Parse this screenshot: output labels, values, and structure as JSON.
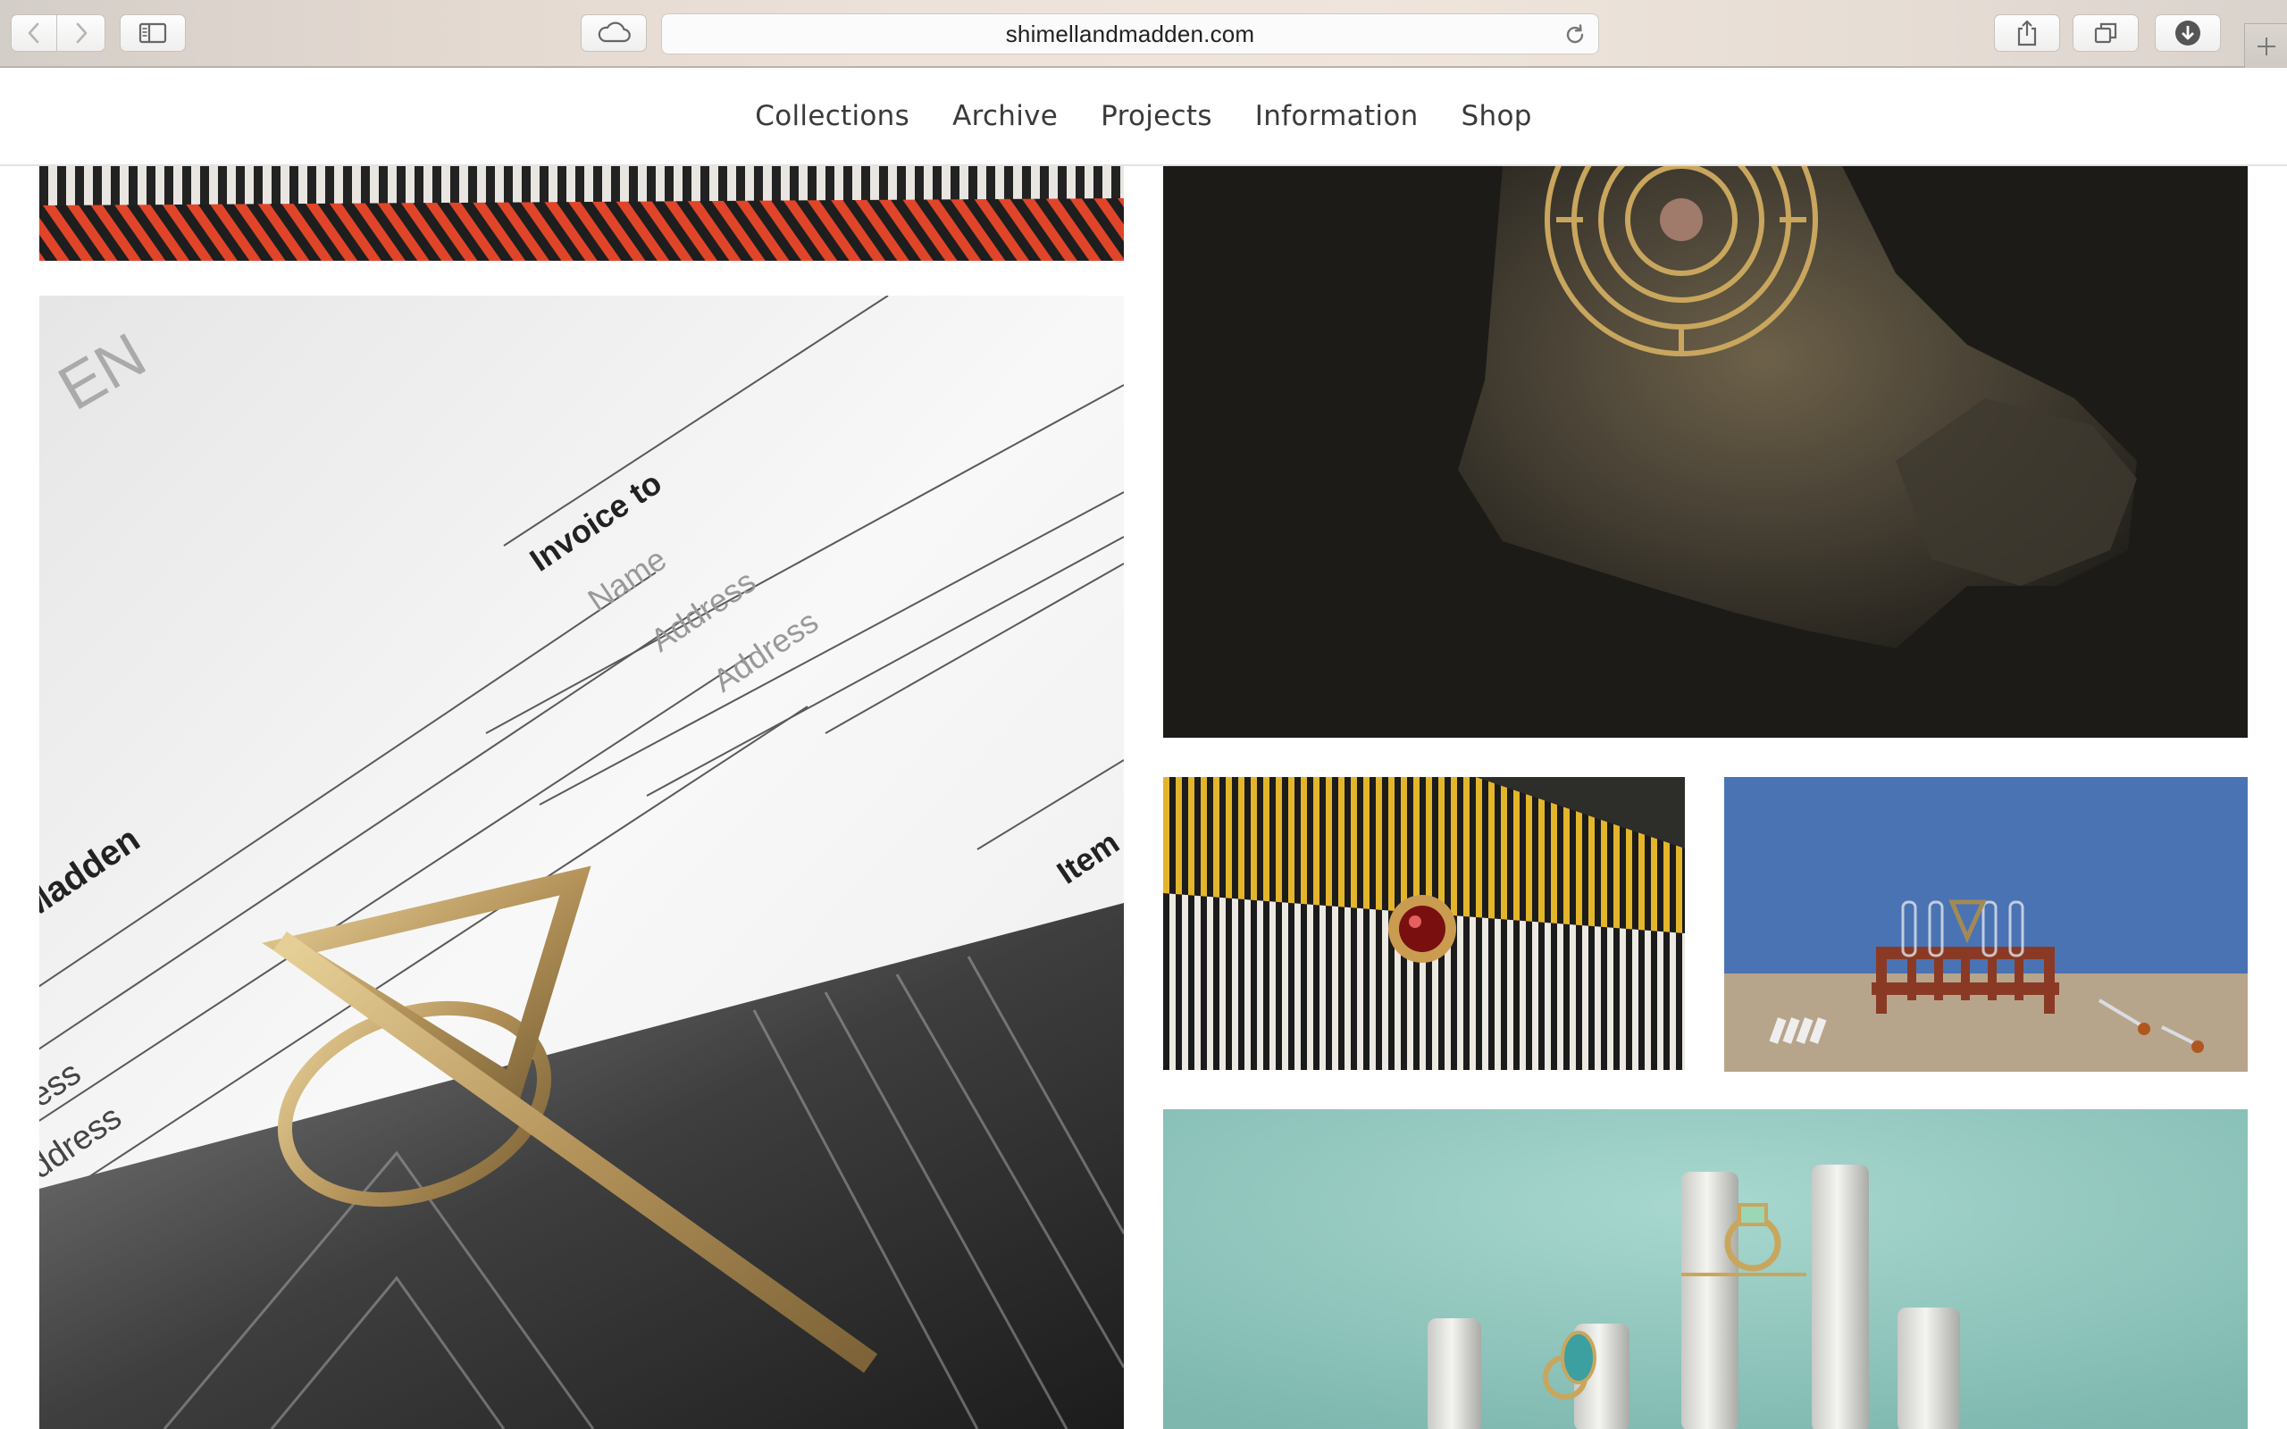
{
  "browser": {
    "url": "shimellandmadden.com",
    "buttons": {
      "back": "back-icon",
      "forward": "forward-icon",
      "sidebar": "sidebar-icon",
      "icloud": "cloud-icon",
      "reload": "reload-icon",
      "share": "share-icon",
      "tabs": "tabs-icon",
      "downloads": "download-icon",
      "new_tab": "plus-icon"
    }
  },
  "nav": {
    "items": [
      {
        "label": "Collections"
      },
      {
        "label": "Archive"
      },
      {
        "label": "Projects"
      },
      {
        "label": "Information"
      },
      {
        "label": "Shop"
      }
    ]
  },
  "invoice_photo": {
    "labels": {
      "brand_fragment": "EN",
      "invoice_to": "Invoice to",
      "name": "Name",
      "address1": "Address",
      "address2": "Address",
      "madden": "Madden",
      "item": "Item",
      "ess": "ess",
      "dress": "ddress"
    }
  },
  "colors": {
    "nav_text": "#3a3a3a",
    "accent_stripe": "#e0452a",
    "teal_bg": "#8fc6bd",
    "blue_bg": "#4a73b4"
  }
}
